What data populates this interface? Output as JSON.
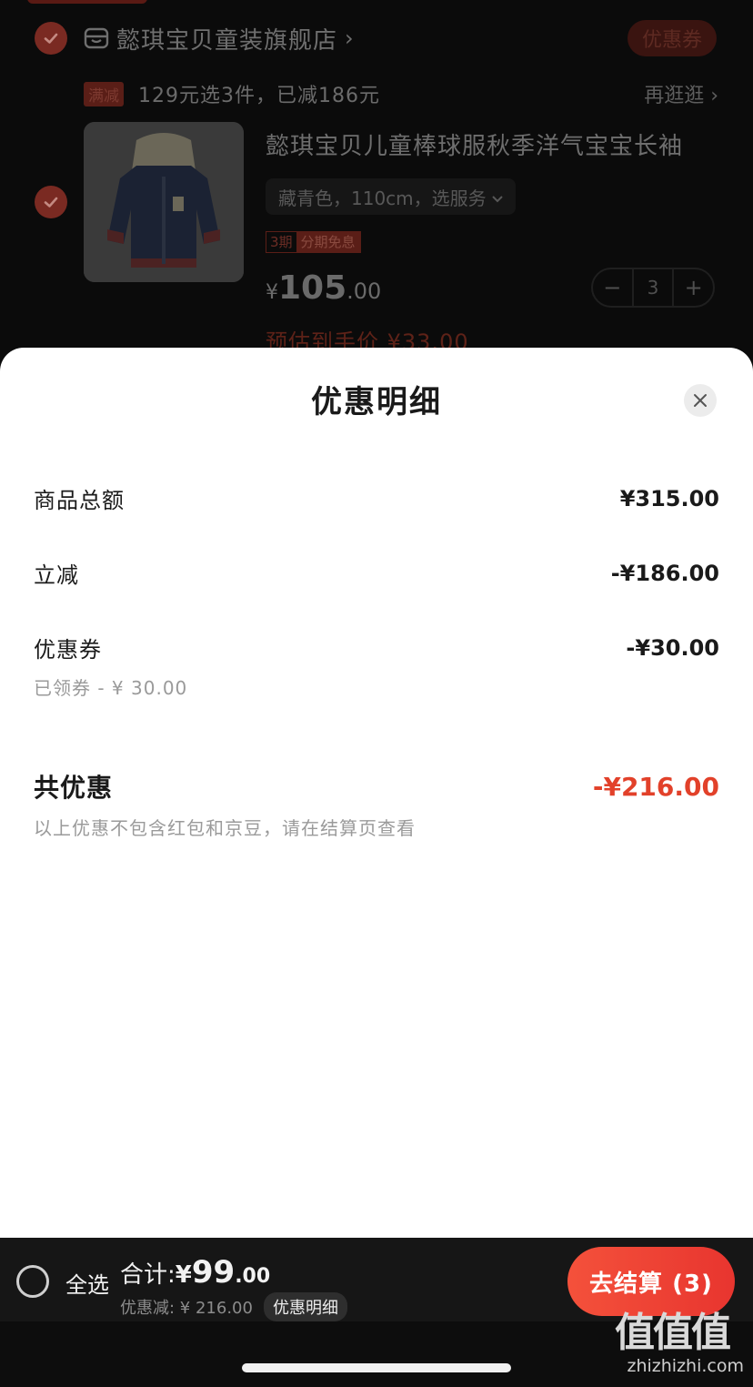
{
  "cart": {
    "shop_name": "懿琪宝贝童装旗舰店",
    "shop_chevron": "›",
    "coupon_button": "优惠券",
    "promo_tag": "满减",
    "promo_text": "129元选3件，已减186元",
    "promo_more": "再逛逛 ›",
    "product_title": "懿琪宝贝儿童棒球服秋季洋气宝宝长袖",
    "sku": "藏青色，110cm，选服务",
    "installment_periods": "3期",
    "installment_text": "分期免息",
    "price_currency": "¥",
    "price_integer": "105",
    "price_decimal": ".00",
    "quantity": "3",
    "minus": "−",
    "plus": "+",
    "estimated_price": "预估到手价 ¥33.00"
  },
  "sheet": {
    "title": "优惠明细",
    "lines": [
      {
        "label": "商品总额",
        "amount": "¥315.00"
      },
      {
        "label": "立减",
        "amount": "-¥186.00"
      },
      {
        "label": "优惠券",
        "amount": "-¥30.00",
        "note": "已领券 - ¥ 30.00"
      }
    ],
    "total": {
      "label": "共优惠",
      "amount": "-¥216.00",
      "note": "以上优惠不包含红包和京豆，请在结算页查看"
    }
  },
  "bottom_bar": {
    "select_all": "全选",
    "total_label": "合计:",
    "total_currency": "¥",
    "total_integer": "99",
    "total_decimal": ".00",
    "discount_text": "优惠减: ¥ 216.00",
    "detail_button": "优惠明细",
    "checkout_button": "去结算 (3)"
  },
  "watermark": {
    "big": "值值值",
    "small": "zhizhizhi.com"
  },
  "colors": {
    "accent": "#e2412a",
    "checkout_gradient_start": "#f4513b",
    "checkout_gradient_end": "#e8352f"
  }
}
